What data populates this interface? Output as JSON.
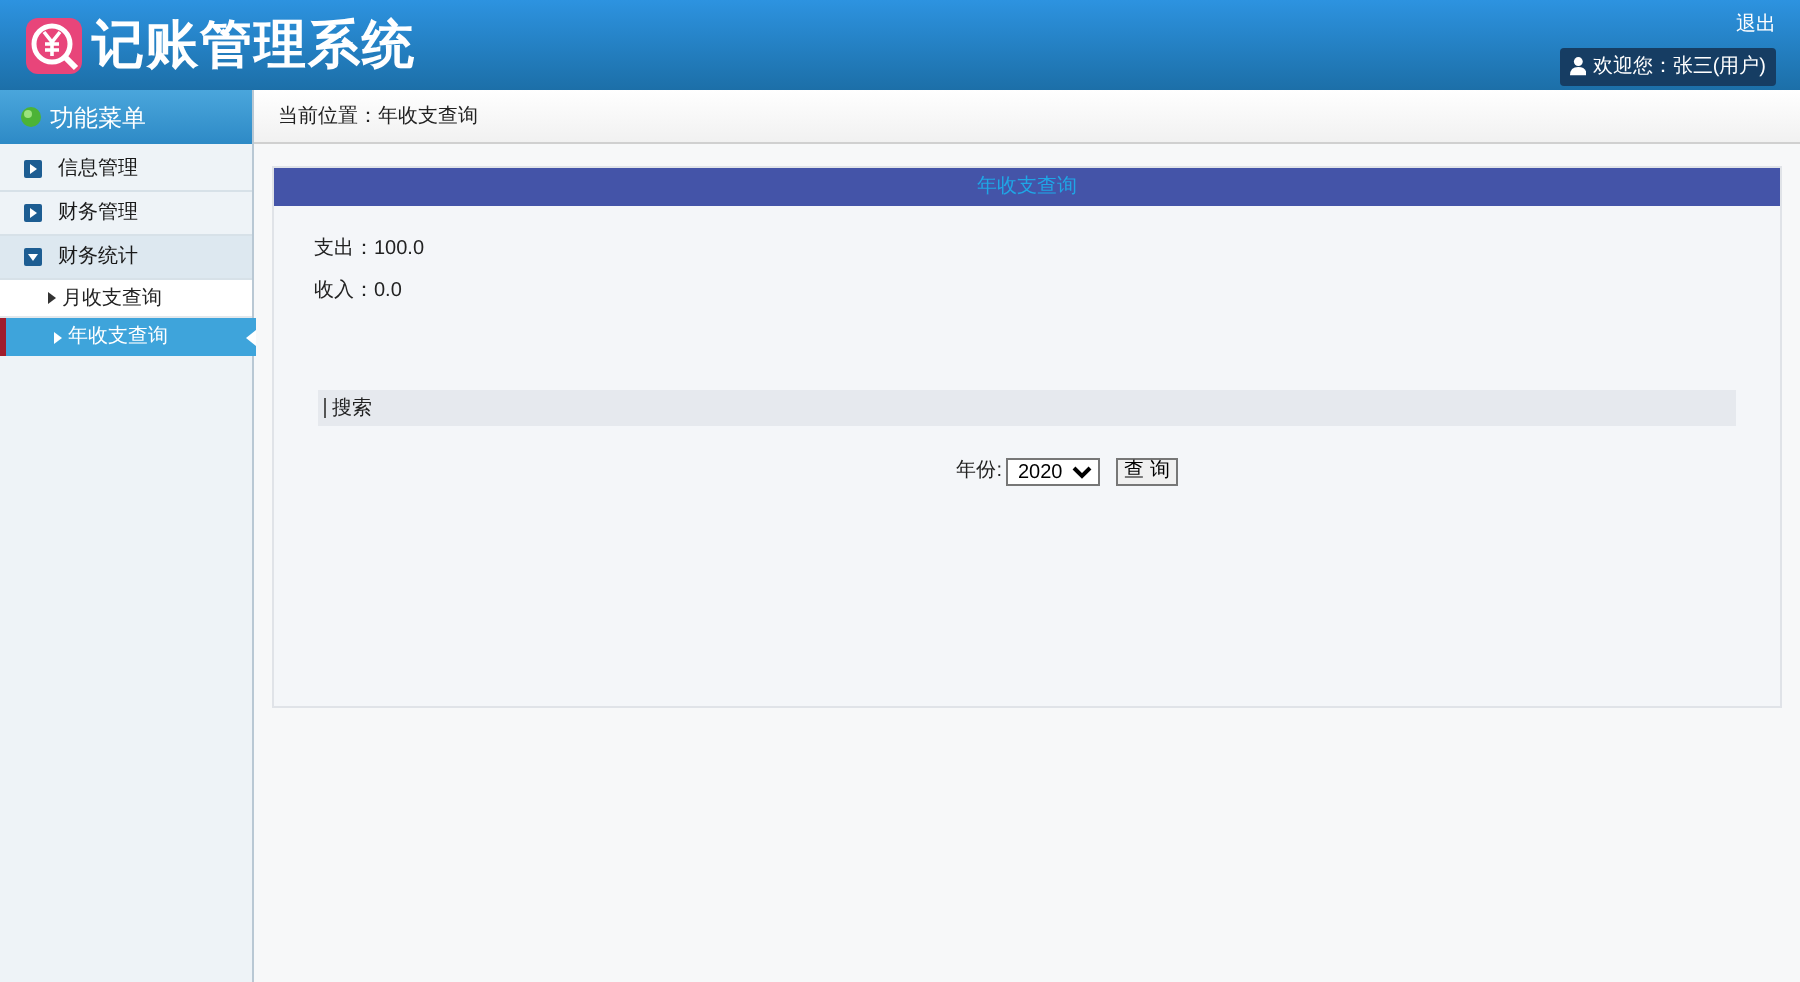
{
  "header": {
    "title": "记账管理系统",
    "logout": "退出",
    "welcome": "欢迎您：张三(用户)"
  },
  "sidebar": {
    "title": "功能菜单",
    "items": [
      {
        "label": "信息管理",
        "expanded": false
      },
      {
        "label": "财务管理",
        "expanded": false
      },
      {
        "label": "财务统计",
        "expanded": true,
        "children": [
          {
            "label": "月收支查询",
            "selected": false
          },
          {
            "label": "年收支查询",
            "selected": true
          }
        ]
      }
    ]
  },
  "breadcrumb": "当前位置：年收支查询",
  "panel": {
    "title": "年收支查询",
    "stats": [
      {
        "label": "支出：",
        "value": "100.0"
      },
      {
        "label": "收入：",
        "value": "0.0"
      }
    ],
    "search": {
      "title": "搜索",
      "year_label": "年份:",
      "year_value": "2020",
      "button": "查 询"
    }
  }
}
